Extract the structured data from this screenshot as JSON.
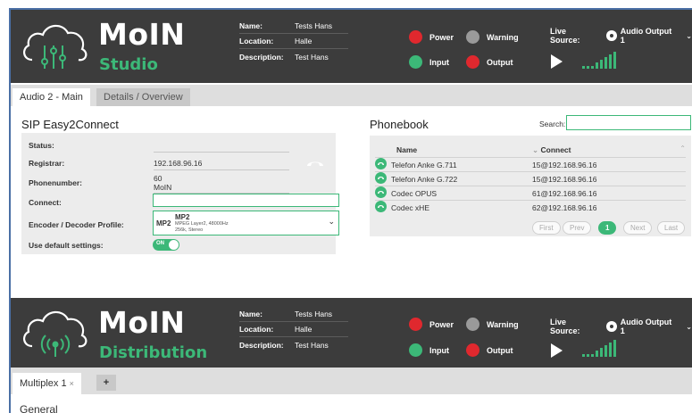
{
  "studio": {
    "brand": "MoIN",
    "product": "Studio",
    "info": [
      {
        "label": "Name:",
        "value": "Tests Hans"
      },
      {
        "label": "Location:",
        "value": "Halle"
      },
      {
        "label": "Description:",
        "value": "Test Hans"
      }
    ],
    "lamps": {
      "power": "Power",
      "warning": "Warning",
      "input": "Input",
      "output": "Output"
    },
    "live_source_label": "Live Source:",
    "live_source_value": "Audio Output 1"
  },
  "tabs": [
    {
      "label": "Audio 2 - Main"
    },
    {
      "label": "Details / Overview"
    }
  ],
  "sip": {
    "title": "SIP Easy2Connect",
    "status_label": "Status:",
    "registrar_label": "Registrar:",
    "registrar_value": "192.168.96.16",
    "phonenumber_label": "Phonenumber:",
    "phonenumber_value": "60",
    "phonenumber_name": "MoIN",
    "connect_label": "Connect:",
    "connect_value": "",
    "profile_label": "Encoder / Decoder Profile:",
    "profile_code": "MP2",
    "profile_name": "MP2",
    "profile_detail1": "MPEG Layer2, 48000Hz",
    "profile_detail2": "256k, Stereo",
    "default_label": "Use default settings:",
    "toggle_text": "ON"
  },
  "phonebook": {
    "title": "Phonebook",
    "search_label": "Search:",
    "search_value": "",
    "col_name": "Name",
    "col_connect": "Connect",
    "rows": [
      {
        "name": "Telefon Anke G.711",
        "connect": "15@192.168.96.16"
      },
      {
        "name": "Telefon Anke G.722",
        "connect": "15@192.168.96.16"
      },
      {
        "name": "Codec OPUS",
        "connect": "61@192.168.96.16"
      },
      {
        "name": "Codec xHE",
        "connect": "62@192.168.96.16"
      }
    ],
    "pager": {
      "first": "First",
      "prev": "Prev",
      "page": "1",
      "next": "Next",
      "last": "Last"
    }
  },
  "distribution": {
    "brand": "MoIN",
    "product": "Distribution",
    "info": [
      {
        "label": "Name:",
        "value": "Tests Hans"
      },
      {
        "label": "Location:",
        "value": "Halle"
      },
      {
        "label": "Description:",
        "value": "Test Hans"
      }
    ],
    "lamps": {
      "power": "Power",
      "warning": "Warning",
      "input": "Input",
      "output": "Output"
    },
    "live_source_label": "Live Source:",
    "live_source_value": "Audio Output 1"
  },
  "multiplex": {
    "tab_label": "Multiplex 1",
    "close_glyph": "×",
    "add_glyph": "+",
    "section": "General"
  },
  "colors": {
    "header_bg": "#3c3c3c",
    "accent": "#3cb878",
    "red": "#e0282e",
    "grey": "#9a9a9a"
  }
}
